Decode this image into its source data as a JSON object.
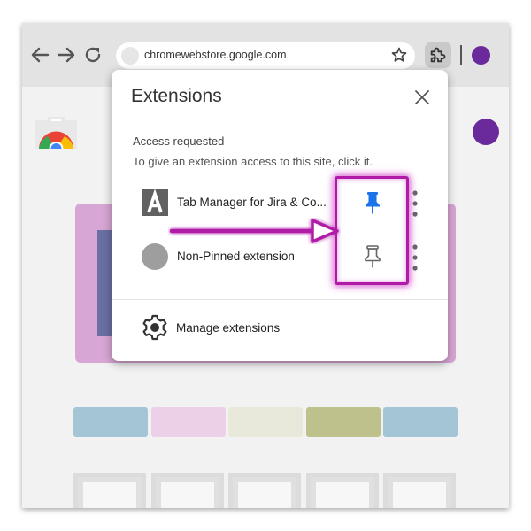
{
  "browser": {
    "url": "chromewebstore.google.com",
    "icons": [
      "back-arrow-icon",
      "forward-arrow-icon",
      "reload-icon",
      "star-icon",
      "puzzle-icon"
    ]
  },
  "popup": {
    "title": "Extensions",
    "access_title": "Access requested",
    "access_desc": "To give an extension access to this site, click it.",
    "extensions": [
      {
        "name": "Tab Manager for Jira & Co...",
        "pinned": true
      },
      {
        "name": "Non-Pinned extension",
        "pinned": false
      }
    ],
    "manage_label": "Manage extensions"
  },
  "colors": {
    "accent_pin": "#1a73e8",
    "highlight": "#b11aa7",
    "profile": "#6a2a9c",
    "banner": "#d7a6d4"
  },
  "tiles": [
    "#a3c5d6",
    "#ebd0e8",
    "#e8e9da",
    "#bfc18c",
    "#a3c5d6"
  ]
}
